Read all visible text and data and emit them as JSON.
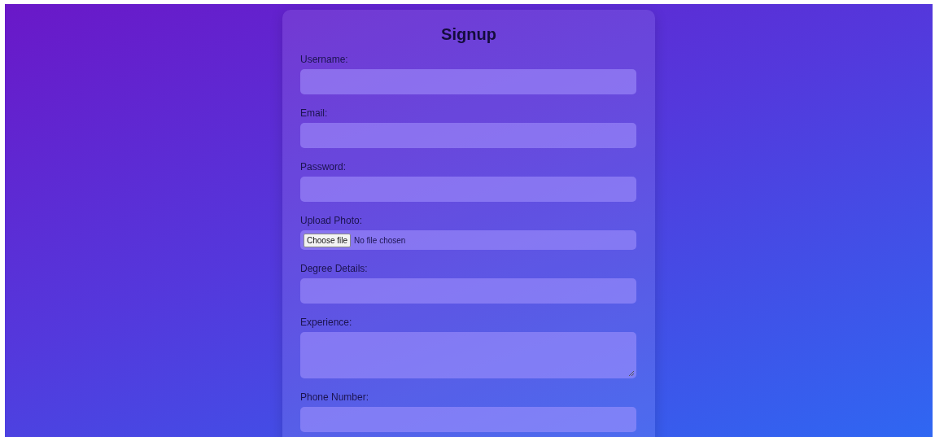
{
  "title": "Signup",
  "fields": [
    {
      "kind": "text",
      "label": "Username:"
    },
    {
      "kind": "text",
      "label": "Email:"
    },
    {
      "kind": "text",
      "label": "Password:"
    },
    {
      "kind": "file",
      "label": "Upload Photo:",
      "button": "Choose file",
      "status": "No file chosen"
    },
    {
      "kind": "text",
      "label": "Degree Details:"
    },
    {
      "kind": "textarea",
      "label": "Experience:"
    },
    {
      "kind": "text",
      "label": "Phone Number:"
    }
  ]
}
